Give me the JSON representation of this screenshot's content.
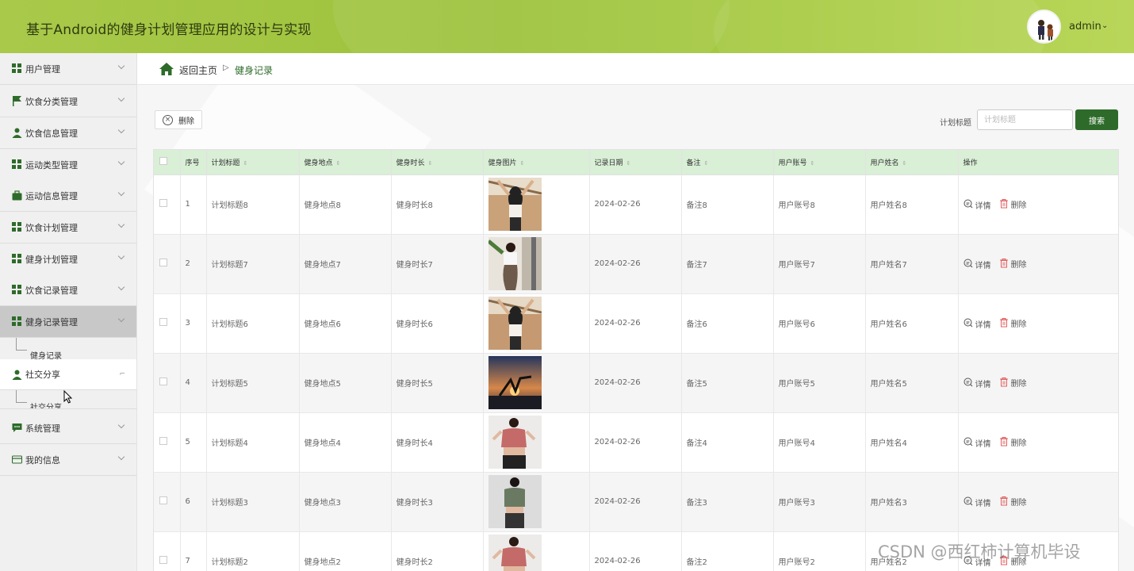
{
  "app": {
    "title": "基于Android的健身计划管理应用的设计与实现",
    "user": "admin",
    "caret": "⌄"
  },
  "sidebar": {
    "items": [
      {
        "label": "用户管理",
        "icon": "grid-icon"
      },
      {
        "label": "饮食分类管理",
        "icon": "flag-icon"
      },
      {
        "label": "饮食信息管理",
        "icon": "user-icon"
      },
      {
        "label": "运动类型管理",
        "icon": "grid-icon"
      },
      {
        "label": "运动信息管理",
        "icon": "briefcase-icon"
      },
      {
        "label": "饮食计划管理",
        "icon": "grid-icon"
      },
      {
        "label": "健身计划管理",
        "icon": "grid-icon"
      },
      {
        "label": "饮食记录管理",
        "icon": "grid-icon"
      },
      {
        "label": "健身记录管理",
        "icon": "grid-icon"
      },
      {
        "label": "社交分享",
        "icon": "user-icon"
      },
      {
        "label": "系统管理",
        "icon": "chat-icon"
      },
      {
        "label": "我的信息",
        "icon": "card-icon"
      }
    ],
    "sub_fitness_record": "健身记录",
    "sub_social_share": "社交分享"
  },
  "breadcrumb": {
    "home": "返回主页",
    "separator": "▷",
    "current": "健身记录"
  },
  "toolbar": {
    "delete_label": "删除",
    "search_label": "计划标题",
    "search_placeholder": "计划标题",
    "search_value": "",
    "search_button": "搜索"
  },
  "table": {
    "columns": [
      "序号",
      "计划标题",
      "健身地点",
      "健身时长",
      "健身图片",
      "记录日期",
      "备注",
      "用户账号",
      "用户姓名",
      "操作"
    ],
    "rows": [
      {
        "index": "1",
        "title": "计划标题8",
        "location": "健身地点8",
        "duration": "健身时长8",
        "date": "2024-02-26",
        "note": "备注8",
        "account": "用户账号8",
        "name": "用户姓名8"
      },
      {
        "index": "2",
        "title": "计划标题7",
        "location": "健身地点7",
        "duration": "健身时长7",
        "date": "2024-02-26",
        "note": "备注7",
        "account": "用户账号7",
        "name": "用户姓名7"
      },
      {
        "index": "3",
        "title": "计划标题6",
        "location": "健身地点6",
        "duration": "健身时长6",
        "date": "2024-02-26",
        "note": "备注6",
        "account": "用户账号6",
        "name": "用户姓名6"
      },
      {
        "index": "4",
        "title": "计划标题5",
        "location": "健身地点5",
        "duration": "健身时长5",
        "date": "2024-02-26",
        "note": "备注5",
        "account": "用户账号5",
        "name": "用户姓名5"
      },
      {
        "index": "5",
        "title": "计划标题4",
        "location": "健身地点4",
        "duration": "健身时长4",
        "date": "2024-02-26",
        "note": "备注4",
        "account": "用户账号4",
        "name": "用户姓名4"
      },
      {
        "index": "6",
        "title": "计划标题3",
        "location": "健身地点3",
        "duration": "健身时长3",
        "date": "2024-02-26",
        "note": "备注3",
        "account": "用户账号3",
        "name": "用户姓名3"
      },
      {
        "index": "7",
        "title": "计划标题2",
        "location": "健身地点2",
        "duration": "健身时长2",
        "date": "2024-02-26",
        "note": "备注2",
        "account": "用户账号2",
        "name": "用户姓名2"
      }
    ],
    "detail_label": "详情",
    "row_delete_label": "删除"
  },
  "watermark": "CSDN @西红柿计算机毕设",
  "colors": {
    "header": "#a9c94a",
    "accent": "#2e6b2a",
    "table_header": "#d9efd6",
    "delete_icon": "#e06060"
  }
}
